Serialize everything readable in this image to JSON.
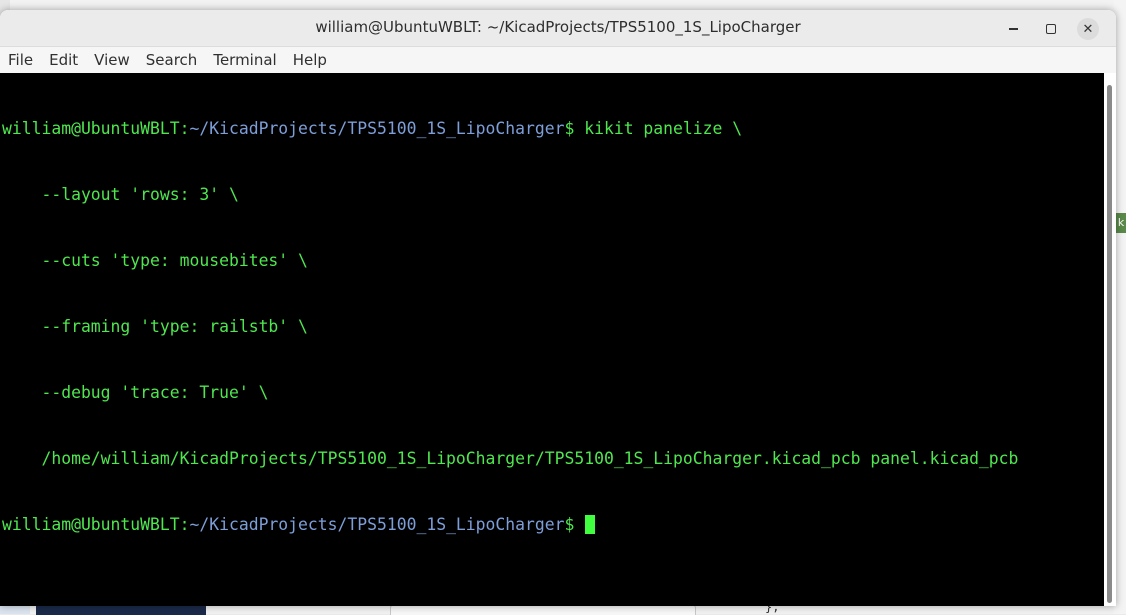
{
  "window": {
    "title": "william@UbuntuWBLT: ~/KicadProjects/TPS5100_1S_LipoCharger",
    "close_symbol": "✕"
  },
  "menubar": {
    "items": [
      "File",
      "Edit",
      "View",
      "Search",
      "Terminal",
      "Help"
    ]
  },
  "terminal": {
    "prompt_user": "william@UbuntuWBLT",
    "prompt_sep": ":",
    "prompt_path": "~/KicadProjects/TPS5100_1S_LipoCharger",
    "prompt_end": "$",
    "command": " kikit panelize \\",
    "continuation_lines": [
      "    --layout 'rows: 3' \\",
      "    --cuts 'type: mousebites' \\",
      "    --framing 'type: railstb' \\",
      "    --debug 'trace: True' \\",
      "    /home/william/KicadProjects/TPS5100_1S_LipoCharger/TPS5100_1S_LipoCharger.kicad_pcb panel.kicad_pcb"
    ],
    "colors": {
      "background": "#000000",
      "user": "#4fe64f",
      "path": "#7d9ed8",
      "cursor": "#3fff3f"
    }
  },
  "background": {
    "side_tab_text": "k",
    "brace_text": "},"
  }
}
